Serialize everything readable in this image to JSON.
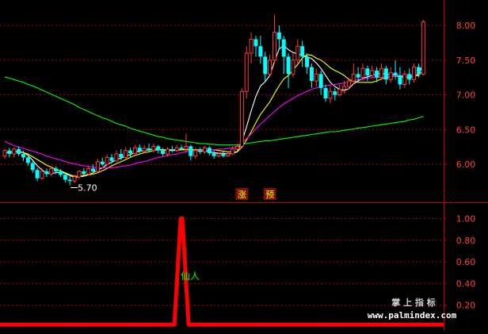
{
  "chart_data": [
    {
      "type": "candlestick",
      "panel": "main",
      "ylim": [
        5.7,
        8.2
      ],
      "y_ticks": [
        "8.00",
        "7.50",
        "7.00",
        "6.50",
        "6.00"
      ],
      "y_tick_values": [
        8.0,
        7.5,
        7.0,
        6.5,
        6.0
      ],
      "grid": "dotted-horizontal",
      "bar_count": 91,
      "low_marker": {
        "label": "5.70",
        "value": 5.7,
        "bar": 14
      },
      "signal_labels": [
        {
          "text": "涨",
          "bar": 51
        },
        {
          "text": "预",
          "bar": 57
        }
      ],
      "colors": {
        "up": "#ff3c3c",
        "down": "#00ffff",
        "ma1": "#ffffff",
        "ma2": "#ffff00",
        "ma3": "#ff00ff",
        "ma4": "#00ff00",
        "signal_bg": "#7a1010",
        "signal_text": "#ffff00"
      },
      "candles": [
        [
          6.12,
          6.2,
          6.22,
          6.08
        ],
        [
          6.2,
          6.15,
          6.24,
          6.1
        ],
        [
          6.15,
          6.22,
          6.25,
          6.1
        ],
        [
          6.22,
          6.15,
          6.26,
          6.12
        ],
        [
          6.15,
          6.1,
          6.2,
          6.05
        ],
        [
          6.1,
          6.02,
          6.14,
          5.98
        ],
        [
          6.02,
          5.92,
          6.05,
          5.88
        ],
        [
          5.92,
          5.8,
          5.95,
          5.76
        ],
        [
          5.8,
          5.9,
          5.95,
          5.78
        ],
        [
          5.9,
          5.86,
          5.94,
          5.82
        ],
        [
          5.86,
          5.94,
          5.98,
          5.83
        ],
        [
          5.94,
          5.9,
          5.97,
          5.86
        ],
        [
          5.9,
          5.85,
          5.93,
          5.82
        ],
        [
          5.85,
          5.78,
          5.88,
          5.74
        ],
        [
          5.78,
          5.76,
          5.86,
          5.7
        ],
        [
          5.76,
          5.82,
          5.85,
          5.73
        ],
        [
          5.82,
          5.9,
          5.92,
          5.79
        ],
        [
          5.9,
          5.86,
          5.95,
          5.84
        ],
        [
          5.86,
          5.94,
          5.98,
          5.84
        ],
        [
          5.94,
          5.9,
          6.0,
          5.87
        ],
        [
          5.9,
          6.04,
          6.08,
          5.88
        ],
        [
          6.04,
          6.0,
          6.1,
          5.98
        ],
        [
          6.0,
          6.1,
          6.14,
          5.98
        ],
        [
          6.1,
          6.05,
          6.15,
          6.02
        ],
        [
          6.05,
          6.15,
          6.2,
          6.03
        ],
        [
          6.15,
          6.1,
          6.22,
          6.06
        ],
        [
          6.1,
          6.2,
          6.25,
          6.08
        ],
        [
          6.2,
          6.16,
          6.24,
          6.1
        ],
        [
          6.16,
          6.24,
          6.28,
          6.13
        ],
        [
          6.24,
          6.19,
          6.29,
          6.16
        ],
        [
          6.19,
          6.23,
          6.28,
          6.16
        ],
        [
          6.23,
          6.2,
          6.3,
          6.18
        ],
        [
          6.2,
          6.26,
          6.3,
          6.17
        ],
        [
          6.26,
          6.2,
          6.28,
          6.16
        ],
        [
          6.2,
          6.15,
          6.24,
          6.12
        ],
        [
          6.15,
          6.22,
          6.25,
          6.11
        ],
        [
          6.22,
          6.2,
          6.27,
          6.17
        ],
        [
          6.2,
          6.24,
          6.28,
          6.18
        ],
        [
          6.24,
          6.22,
          6.28,
          6.2
        ],
        [
          6.22,
          6.26,
          6.44,
          6.18
        ],
        [
          6.26,
          6.12,
          6.28,
          6.06
        ],
        [
          6.12,
          6.2,
          6.24,
          6.08
        ],
        [
          6.2,
          6.18,
          6.24,
          6.15
        ],
        [
          6.18,
          6.24,
          6.27,
          6.15
        ],
        [
          6.24,
          6.16,
          6.26,
          6.13
        ],
        [
          6.16,
          6.12,
          6.2,
          6.08
        ],
        [
          6.12,
          6.15,
          6.18,
          6.1
        ],
        [
          6.15,
          6.12,
          6.18,
          6.1
        ],
        [
          6.12,
          6.15,
          6.18,
          6.11
        ],
        [
          6.15,
          6.22,
          6.26,
          6.14
        ],
        [
          6.22,
          6.26,
          6.3,
          6.2
        ],
        [
          6.26,
          7.05,
          7.1,
          6.26
        ],
        [
          7.05,
          7.6,
          7.7,
          6.95
        ],
        [
          7.6,
          7.8,
          7.9,
          7.45
        ],
        [
          7.8,
          7.7,
          7.85,
          7.55
        ],
        [
          7.7,
          7.55,
          7.85,
          7.45
        ],
        [
          7.55,
          7.3,
          7.62,
          7.2
        ],
        [
          7.3,
          7.5,
          7.58,
          7.28
        ],
        [
          7.5,
          7.9,
          8.15,
          7.45
        ],
        [
          7.9,
          7.8,
          8.0,
          7.65
        ],
        [
          7.8,
          7.55,
          7.85,
          7.3
        ],
        [
          7.55,
          7.3,
          7.6,
          7.1
        ],
        [
          7.3,
          7.5,
          7.6,
          7.25
        ],
        [
          7.5,
          7.7,
          7.8,
          7.45
        ],
        [
          7.7,
          7.55,
          7.78,
          7.4
        ],
        [
          7.55,
          7.4,
          7.6,
          7.3
        ],
        [
          7.4,
          7.2,
          7.45,
          7.1
        ],
        [
          7.2,
          7.3,
          7.38,
          7.12
        ],
        [
          7.3,
          7.1,
          7.35,
          7.0
        ],
        [
          7.1,
          6.95,
          7.15,
          6.9
        ],
        [
          6.95,
          7.05,
          7.12,
          6.88
        ],
        [
          7.05,
          7.0,
          7.1,
          6.92
        ],
        [
          7.0,
          7.08,
          7.15,
          6.98
        ],
        [
          7.08,
          7.12,
          7.2,
          7.02
        ],
        [
          7.12,
          7.2,
          7.25,
          7.08
        ],
        [
          7.2,
          7.3,
          7.45,
          7.15
        ],
        [
          7.3,
          7.25,
          7.4,
          7.18
        ],
        [
          7.25,
          7.38,
          7.45,
          7.2
        ],
        [
          7.38,
          7.28,
          7.42,
          7.2
        ],
        [
          7.28,
          7.35,
          7.42,
          7.25
        ],
        [
          7.35,
          7.25,
          7.4,
          7.18
        ],
        [
          7.25,
          7.38,
          7.45,
          7.22
        ],
        [
          7.38,
          7.22,
          7.42,
          7.15
        ],
        [
          7.22,
          7.32,
          7.4,
          7.18
        ],
        [
          7.32,
          7.28,
          7.5,
          7.22
        ],
        [
          7.28,
          7.15,
          7.4,
          7.08
        ],
        [
          7.15,
          7.3,
          7.35,
          7.1
        ],
        [
          7.3,
          7.22,
          7.38,
          7.15
        ],
        [
          7.22,
          7.4,
          7.45,
          7.18
        ],
        [
          7.4,
          7.3,
          7.45,
          7.25
        ],
        [
          7.3,
          8.05,
          8.08,
          7.28
        ]
      ],
      "ma_lines": [
        [
          6.17,
          6.17,
          6.18,
          6.19,
          6.17,
          6.13,
          6.06,
          5.98,
          5.92,
          5.88,
          5.87,
          5.88,
          5.89,
          5.87,
          5.84,
          5.81,
          5.82,
          5.83,
          5.85,
          5.88,
          5.92,
          5.95,
          6.0,
          6.03,
          6.07,
          6.09,
          6.12,
          6.14,
          6.17,
          6.19,
          6.2,
          6.21,
          6.22,
          6.22,
          6.21,
          6.2,
          6.2,
          6.2,
          6.21,
          6.22,
          6.21,
          6.2,
          6.19,
          6.2,
          6.18,
          6.17,
          6.16,
          6.16,
          6.15,
          6.16,
          6.18,
          6.33,
          6.54,
          6.77,
          6.98,
          7.13,
          7.19,
          7.28,
          7.48,
          7.66,
          7.71,
          7.65,
          7.61,
          7.59,
          7.57,
          7.55,
          7.52,
          7.46,
          7.38,
          7.28,
          7.18,
          7.12,
          7.08,
          7.06,
          7.09,
          7.16,
          7.2,
          7.24,
          7.26,
          7.28,
          7.3,
          7.31,
          7.3,
          7.29,
          7.29,
          7.27,
          7.26,
          7.25,
          7.27,
          7.29,
          7.45
        ],
        [
          6.17,
          6.17,
          6.18,
          6.18,
          6.17,
          6.15,
          6.11,
          6.07,
          6.03,
          5.99,
          5.96,
          5.93,
          5.91,
          5.88,
          5.85,
          5.83,
          5.83,
          5.84,
          5.85,
          5.86,
          5.88,
          5.91,
          5.94,
          5.98,
          6.01,
          6.04,
          6.07,
          6.1,
          6.13,
          6.15,
          6.17,
          6.18,
          6.2,
          6.21,
          6.21,
          6.21,
          6.21,
          6.21,
          6.21,
          6.21,
          6.21,
          6.21,
          6.21,
          6.21,
          6.21,
          6.21,
          6.2,
          6.19,
          6.18,
          6.18,
          6.18,
          6.25,
          6.35,
          6.47,
          6.6,
          6.72,
          6.81,
          6.9,
          7.02,
          7.13,
          7.23,
          7.28,
          7.36,
          7.44,
          7.53,
          7.58,
          7.57,
          7.53,
          7.5,
          7.45,
          7.39,
          7.35,
          7.32,
          7.28,
          7.22,
          7.2,
          7.18,
          7.18,
          7.18,
          7.18,
          7.2,
          7.23,
          7.25,
          7.26,
          7.27,
          7.26,
          7.25,
          7.26,
          7.27,
          7.28,
          7.35
        ],
        [
          6.33,
          6.3,
          6.27,
          6.25,
          6.23,
          6.21,
          6.19,
          6.17,
          6.15,
          6.12,
          6.1,
          6.08,
          6.06,
          6.04,
          6.02,
          6.01,
          5.99,
          5.98,
          5.97,
          5.96,
          5.95,
          5.95,
          5.95,
          5.95,
          5.96,
          5.97,
          5.98,
          5.99,
          6.01,
          6.03,
          6.04,
          6.06,
          6.08,
          6.1,
          6.11,
          6.13,
          6.14,
          6.15,
          6.17,
          6.18,
          6.19,
          6.2,
          6.2,
          6.21,
          6.21,
          6.21,
          6.22,
          6.22,
          6.23,
          6.24,
          6.26,
          6.31,
          6.37,
          6.44,
          6.51,
          6.58,
          6.64,
          6.7,
          6.76,
          6.82,
          6.87,
          6.91,
          6.95,
          6.99,
          7.02,
          7.05,
          7.08,
          7.1,
          7.12,
          7.13,
          7.14,
          7.15,
          7.16,
          7.17,
          7.19,
          7.2,
          7.22,
          7.23,
          7.24,
          7.25,
          7.25,
          7.26,
          7.26,
          7.27,
          7.27,
          7.28,
          7.28,
          7.28,
          7.29,
          7.3,
          7.32
        ],
        [
          7.26,
          7.24,
          7.22,
          7.2,
          7.18,
          7.15,
          7.13,
          7.1,
          7.07,
          7.04,
          7.01,
          6.98,
          6.95,
          6.92,
          6.89,
          6.86,
          6.82,
          6.79,
          6.76,
          6.73,
          6.7,
          6.67,
          6.65,
          6.62,
          6.59,
          6.57,
          6.55,
          6.52,
          6.5,
          6.48,
          6.46,
          6.44,
          6.42,
          6.4,
          6.39,
          6.37,
          6.36,
          6.35,
          6.34,
          6.33,
          6.32,
          6.31,
          6.3,
          6.3,
          6.29,
          6.29,
          6.28,
          6.28,
          6.28,
          6.28,
          6.28,
          6.29,
          6.3,
          6.31,
          6.32,
          6.33,
          6.34,
          6.34,
          6.35,
          6.36,
          6.37,
          6.38,
          6.39,
          6.4,
          6.41,
          6.42,
          6.43,
          6.44,
          6.45,
          6.46,
          6.47,
          6.47,
          6.48,
          6.49,
          6.5,
          6.51,
          6.52,
          6.53,
          6.54,
          6.55,
          6.56,
          6.57,
          6.58,
          6.59,
          6.6,
          6.61,
          6.62,
          6.64,
          6.65,
          6.67,
          6.69
        ]
      ]
    },
    {
      "type": "line",
      "panel": "indicator",
      "ylim": [
        0,
        1.1
      ],
      "y_ticks": [
        "1.00",
        "0.80",
        "0.60",
        "0.40",
        "0.20"
      ],
      "y_tick_values": [
        1.0,
        0.8,
        0.6,
        0.4,
        0.2
      ],
      "line_color": "#ff0000",
      "values": [
        0,
        0,
        0,
        0,
        0,
        0,
        0,
        0,
        0,
        0,
        0,
        0,
        0,
        0,
        0,
        0,
        0,
        0,
        0,
        0,
        0,
        0,
        0,
        0,
        0,
        0,
        0,
        0,
        0,
        0,
        0,
        0,
        0,
        0,
        0,
        0,
        0,
        0,
        0,
        0,
        0,
        0,
        0,
        0,
        0,
        0,
        0,
        0,
        0,
        0,
        0,
        0,
        0,
        0,
        0,
        0,
        0,
        0,
        0,
        0,
        0,
        0,
        0,
        0,
        0,
        0,
        0,
        0,
        0,
        0,
        0,
        0,
        0,
        0,
        0,
        0,
        0,
        0,
        0,
        0,
        0,
        0,
        0,
        0,
        0,
        0,
        0,
        0,
        0,
        0,
        0
      ],
      "spike": {
        "bar": 38,
        "value": 1.0,
        "base_value": 0.02
      },
      "annotation": {
        "text": "仙人",
        "value": 0.47,
        "color": "#00ff00"
      }
    }
  ],
  "watermark": {
    "brand": "掌 上 指 标",
    "site": "www.palmindex.com"
  }
}
